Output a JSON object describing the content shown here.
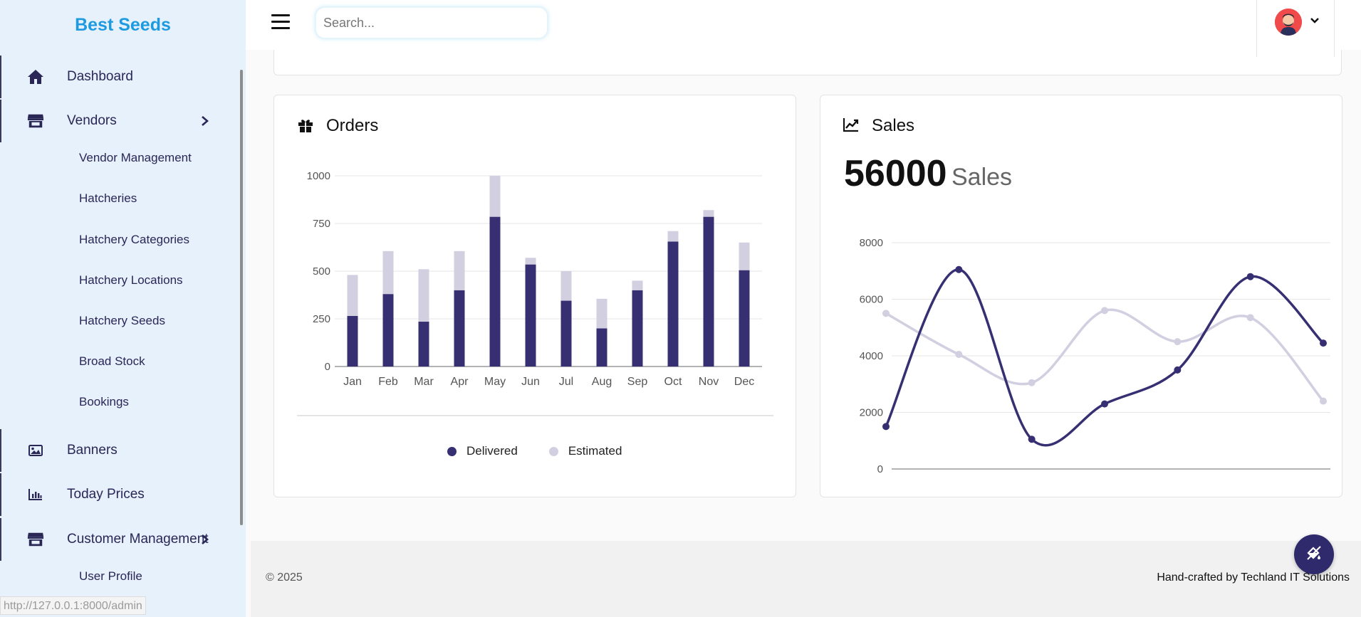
{
  "sidebar": {
    "brand": "Best Seeds",
    "items": [
      {
        "label": "Dashboard",
        "icon": "home-icon"
      },
      {
        "label": "Vendors",
        "icon": "store-icon"
      },
      {
        "label": "Banners",
        "icon": "image-icon"
      },
      {
        "label": "Today Prices",
        "icon": "bar-chart-icon"
      },
      {
        "label": "Customer Management",
        "icon": "store-icon"
      }
    ],
    "vendor_subitems": [
      "Vendor Management",
      "Hatcheries",
      "Hatchery Categories",
      "Hatchery Locations",
      "Hatchery Seeds",
      "Broad Stock",
      "Bookings"
    ],
    "customer_subitems": [
      "User Profile"
    ]
  },
  "status_url": "http://127.0.0.1:8000/admin",
  "header": {
    "search_placeholder": "Search..."
  },
  "orders_card": {
    "title": "Orders",
    "legend": [
      "Delivered",
      "Estimated"
    ]
  },
  "sales_card": {
    "title": "Sales",
    "total": "56000",
    "unit": "Sales"
  },
  "footer": {
    "copyright": "© 2025",
    "credit": "Hand-crafted by Techland IT Solutions"
  },
  "colors": {
    "primary": "#362f72",
    "secondary": "#d2cfe0",
    "brand": "#1e9be0",
    "sidebar_bg": "#e6f1fb"
  },
  "chart_data": [
    {
      "type": "bar",
      "stacked": true,
      "title": "Orders",
      "categories": [
        "Jan",
        "Feb",
        "Mar",
        "Apr",
        "May",
        "Jun",
        "Jul",
        "Aug",
        "Sep",
        "Oct",
        "Nov",
        "Dec"
      ],
      "series": [
        {
          "name": "Delivered",
          "color": "#362f72",
          "values": [
            265,
            380,
            235,
            400,
            785,
            535,
            345,
            200,
            400,
            655,
            785,
            505
          ]
        },
        {
          "name": "Estimated",
          "color": "#d2cfe0",
          "values": [
            215,
            225,
            275,
            205,
            215,
            35,
            155,
            155,
            50,
            55,
            35,
            145
          ]
        }
      ],
      "ylim": [
        0,
        1000
      ],
      "yticks": [
        0,
        250,
        500,
        750,
        1000
      ],
      "grid": true,
      "legend": "bottom"
    },
    {
      "type": "line",
      "smooth": true,
      "x": [
        0,
        1,
        2,
        3,
        4,
        5,
        6
      ],
      "series": [
        {
          "name": "Delivered",
          "color": "#362f72",
          "values": [
            1500,
            7050,
            1050,
            2300,
            3500,
            6800,
            4450
          ]
        },
        {
          "name": "Estimated",
          "color": "#d2cfe0",
          "values": [
            5500,
            4050,
            3050,
            5600,
            4500,
            5350,
            2400
          ]
        }
      ],
      "ylim": [
        0,
        8000
      ],
      "yticks": [
        0,
        2000,
        4000,
        6000,
        8000
      ],
      "grid": true,
      "legend": "none"
    }
  ]
}
